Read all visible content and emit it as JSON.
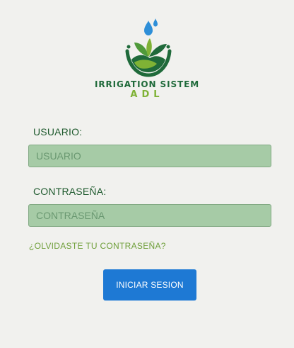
{
  "brand": {
    "title": "IRRIGATION SISTEM",
    "subtitle": "ADL",
    "logo_icon": "water-drops-leaves-bowl"
  },
  "form": {
    "username_label": "USUARIO:",
    "username_placeholder": "USUARIO",
    "username_value": "",
    "password_label": "CONTRASEÑA:",
    "password_placeholder": "CONTRASEÑA",
    "password_value": "",
    "forgot_link": "¿OLVIDASTE TU CONTRASEÑA?",
    "submit_label": "INICIAR SESION"
  },
  "colors": {
    "background": "#f1f1ee",
    "input_fill": "#a6cba6",
    "label_green": "#1f5a2e",
    "brand_dark_green": "#1f6a3a",
    "brand_light_green": "#7fb235",
    "drop_blue": "#2e8fd8",
    "button_blue": "#1e79d4"
  }
}
